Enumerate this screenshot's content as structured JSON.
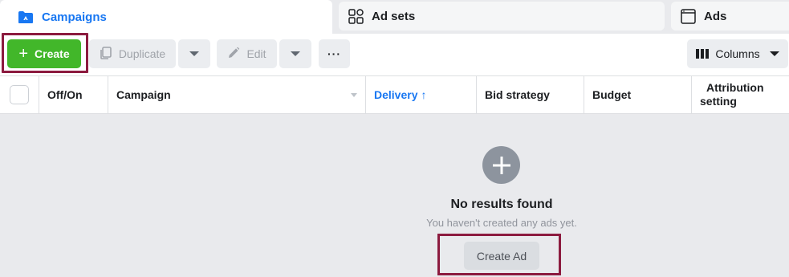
{
  "tabs": {
    "campaigns": "Campaigns",
    "adsets": "Ad sets",
    "ads": "Ads"
  },
  "toolbar": {
    "create_label": "Create",
    "duplicate_label": "Duplicate",
    "edit_label": "Edit",
    "more_label": "···",
    "columns_label": "Columns"
  },
  "table": {
    "headers": {
      "offon": "Off/On",
      "campaign": "Campaign",
      "delivery": "Delivery",
      "delivery_sort": "↑",
      "bid": "Bid strategy",
      "budget": "Budget",
      "attribution_line1": "Attribution",
      "attribution_line2": "setting"
    }
  },
  "empty_state": {
    "title": "No results found",
    "subtitle": "You haven't created any ads yet.",
    "button_label": "Create Ad"
  },
  "colors": {
    "accent": "#1877f2",
    "create_green": "#42b72a",
    "highlight_border": "#8c1b3f"
  },
  "icons": {
    "campaigns_tab": "folder-icon",
    "adsets_tab": "grid-icon",
    "ads_tab": "window-icon",
    "create": "plus-icon",
    "duplicate": "duplicate-icon",
    "edit": "pencil-icon",
    "columns": "columns-icon",
    "empty_state": "plus-circle-icon"
  }
}
